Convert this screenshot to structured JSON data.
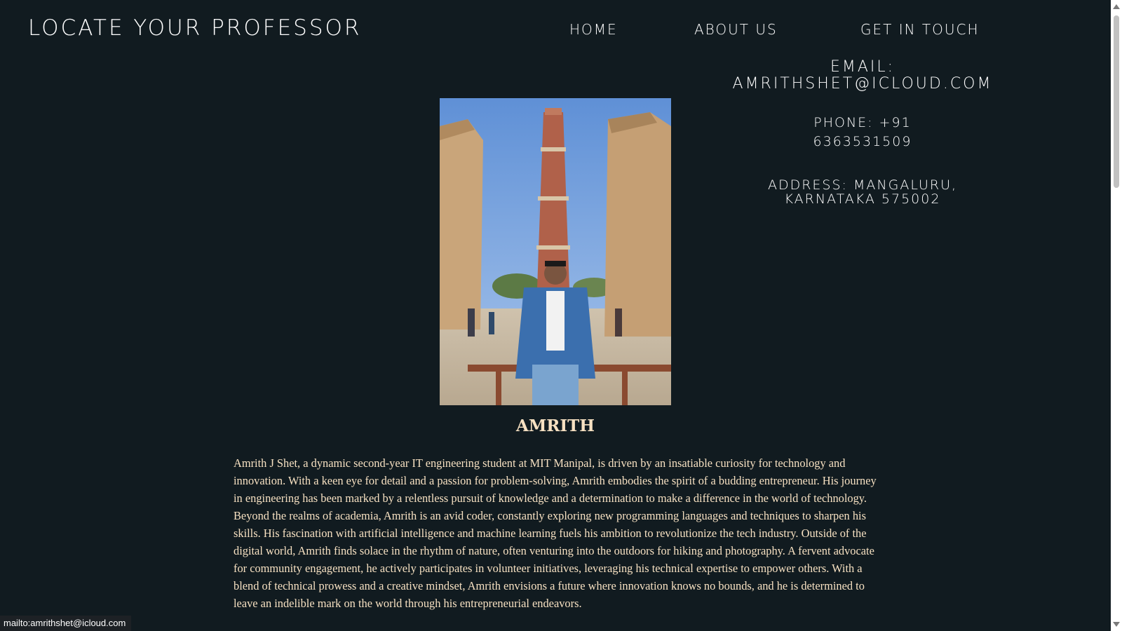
{
  "header": {
    "site_title": "Locate your Professor",
    "nav": [
      "Home",
      "About us",
      "Get in Touch"
    ]
  },
  "contact": {
    "email_label": "Email:",
    "email_value": "amrithshet@icloud.com",
    "phone_label": "Phone: +91",
    "phone_value": "6363531509",
    "address_line1": "Address: Mangaluru,",
    "address_line2": "Karnataka 575002"
  },
  "profile": {
    "name": "AMRITH",
    "bio": "Amrith J Shet, a dynamic second-year IT engineering student at MIT Manipal, is driven by an insatiable curiosity for technology and innovation. With a keen eye for detail and a passion for problem-solving, Amrith embodies the spirit of a budding entrepreneur. His journey in engineering has been marked by a relentless pursuit of knowledge and a determination to make a difference in the world of technology. Beyond the realms of academia, Amrith is an avid coder, constantly exploring new programming languages and techniques to sharpen his skills. His fascination with artificial intelligence and machine learning fuels his ambition to revolutionize the tech industry. Outside of the digital world, Amrith finds solace in the rhythm of nature, often venturing into the outdoors for hiking and photography. A fervent advocate for community engagement, he actively participates in volunteer initiatives, leveraging his technical expertise to empower others. With a blend of technical prowess and a creative mindset, Amrith envisions a future where innovation knows no bounds, and he is determined to leave an indelible mark on the world through his entrepreneurial endeavors."
  },
  "status_bar": {
    "link_preview": "mailto:amrithshet@icloud.com"
  },
  "colors": {
    "background": "#111b20",
    "text_warm": "#f7e1c2",
    "text_white": "#ffffff"
  }
}
